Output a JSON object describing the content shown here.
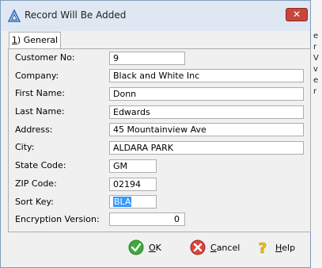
{
  "window": {
    "title": "Record Will Be Added",
    "close_label": "✕"
  },
  "tabs": [
    {
      "label": "1) General",
      "accel": "1"
    }
  ],
  "form": {
    "customer_no_label": "Customer No:",
    "customer_no": "9",
    "company_label": "Company:",
    "company": "Black and White Inc",
    "first_name_label": "First Name:",
    "first_name": "Donn",
    "last_name_label": "Last Name:",
    "last_name": "Edwards",
    "address_label": "Address:",
    "address": "45 Mountainview Ave",
    "city_label": "City:",
    "city": "ALDARA PARK",
    "state_label": "State Code:",
    "state": "GM",
    "zip_label": "ZIP Code:",
    "zip": "02194",
    "sort_key_label": "Sort Key:",
    "sort_key": "BLA",
    "encryption_label": "Encryption Version:",
    "encryption": "0"
  },
  "buttons": {
    "ok": {
      "accel": "O",
      "rest": "K",
      "icon": "check-icon"
    },
    "cancel": {
      "accel": "C",
      "rest": "ancel",
      "icon": "cancel-icon"
    },
    "help": {
      "accel": "H",
      "rest": "elp",
      "icon": "help-icon"
    }
  },
  "background_text": [
    "e",
    "r",
    "V",
    "v",
    "e",
    "r"
  ]
}
